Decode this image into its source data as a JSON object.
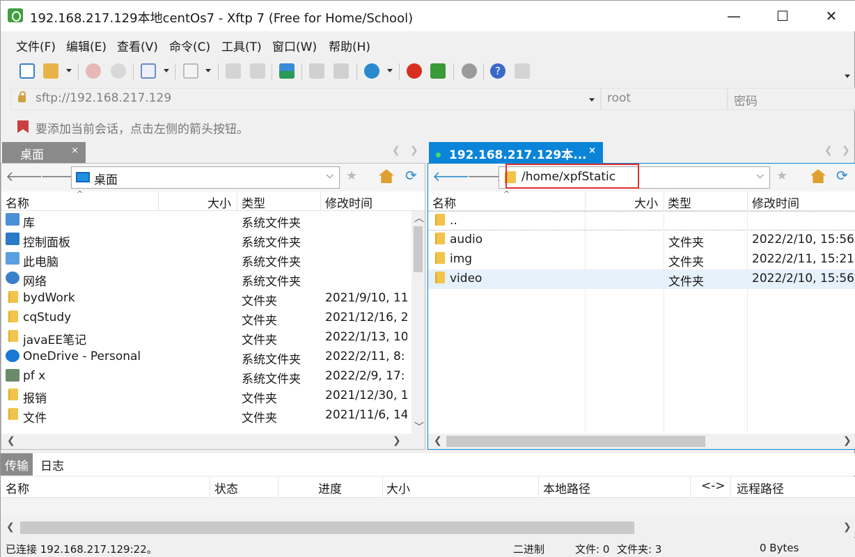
{
  "window": {
    "title": "192.168.217.129本地centOs7 - Xftp 7 (Free for Home/School)",
    "minimize": "—",
    "maximize": "☐",
    "close": "✕"
  },
  "menu": [
    "文件(F)",
    "编辑(E)",
    "查看(V)",
    "命令(C)",
    "工具(T)",
    "窗口(W)",
    "帮助(H)"
  ],
  "address": {
    "url": "sftp://192.168.217.129",
    "user": "root",
    "password_placeholder": "密码"
  },
  "hint": "要添加当前会话，点击左侧的箭头按钮。",
  "left_tab": {
    "label": "桌面",
    "close": "×"
  },
  "right_tab": {
    "label": "192.168.217.129本...",
    "close": "×"
  },
  "left_panel": {
    "path": "桌面",
    "columns": [
      "名称",
      "大小",
      "类型",
      "修改时间"
    ],
    "rows": [
      {
        "name": "库",
        "size": "",
        "type": "系统文件夹",
        "modified": "",
        "icon": "library-icon"
      },
      {
        "name": "控制面板",
        "size": "",
        "type": "系统文件夹",
        "modified": "",
        "icon": "control-panel-icon"
      },
      {
        "name": "此电脑",
        "size": "",
        "type": "系统文件夹",
        "modified": "",
        "icon": "computer-icon"
      },
      {
        "name": "网络",
        "size": "",
        "type": "系统文件夹",
        "modified": "",
        "icon": "network-icon"
      },
      {
        "name": "bydWork",
        "size": "",
        "type": "文件夹",
        "modified": "2021/9/10, 11",
        "icon": "folder-icon"
      },
      {
        "name": "cqStudy",
        "size": "",
        "type": "文件夹",
        "modified": "2021/12/16, 2",
        "icon": "folder-icon"
      },
      {
        "name": "javaEE笔记",
        "size": "",
        "type": "文件夹",
        "modified": "2022/1/13, 10",
        "icon": "folder-icon"
      },
      {
        "name": "OneDrive - Personal",
        "size": "",
        "type": "系统文件夹",
        "modified": "2022/2/11, 8:",
        "icon": "onedrive-icon"
      },
      {
        "name": "pf x",
        "size": "",
        "type": "系统文件夹",
        "modified": "2022/2/9, 17:",
        "icon": "user-icon"
      },
      {
        "name": "报销",
        "size": "",
        "type": "文件夹",
        "modified": "2021/12/30, 1",
        "icon": "folder-icon"
      },
      {
        "name": "文件",
        "size": "",
        "type": "文件夹",
        "modified": "2021/11/6, 14",
        "icon": "folder-icon"
      }
    ]
  },
  "right_panel": {
    "path": "/home/xpfStatic",
    "columns": [
      "名称",
      "大小",
      "类型",
      "修改时间"
    ],
    "rows": [
      {
        "name": "..",
        "size": "",
        "type": "",
        "modified": ""
      },
      {
        "name": "audio",
        "size": "",
        "type": "文件夹",
        "modified": "2022/2/10, 15:56"
      },
      {
        "name": "img",
        "size": "",
        "type": "文件夹",
        "modified": "2022/2/11, 15:21"
      },
      {
        "name": "video",
        "size": "",
        "type": "文件夹",
        "modified": "2022/2/10, 15:56"
      }
    ]
  },
  "bottom_tabs": [
    "传输",
    "日志"
  ],
  "transfer_columns": [
    "名称",
    "状态",
    "进度",
    "大小",
    "本地路径",
    "<->",
    "远程路径"
  ],
  "status": {
    "connection": "已连接 192.168.217.129:22。",
    "mode": "二进制",
    "files": "文件: 0",
    "folders": "文件夹: 3",
    "bytes": "0 Bytes"
  },
  "colors": {
    "accent": "#0a84d8",
    "tab_inactive": "#8a8a8a",
    "selected_row": "#e5f1fb",
    "highlight_box": "#e03030"
  }
}
